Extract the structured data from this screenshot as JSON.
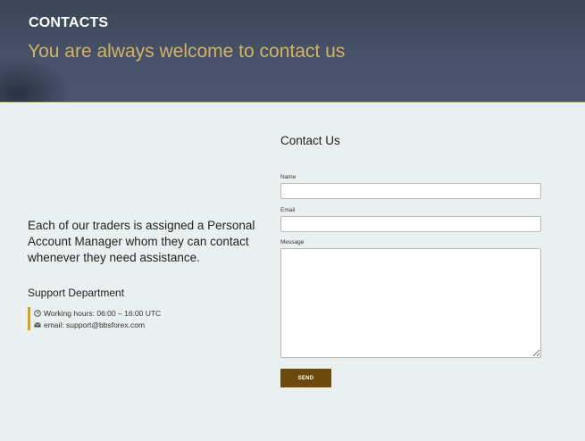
{
  "header": {
    "title": "CONTACTS",
    "subtitle": "You are always welcome to contact us"
  },
  "info": {
    "description": "Each of our traders is assigned a Personal Account Manager whom they can contact whenever they need assistance.",
    "support_title": "Support Department",
    "working_hours": "Working hours: 06:00 – 16:00 UTC",
    "email": "email: support@bbsforex.com",
    "accent_color": "#d6a21e",
    "icons": [
      "clock-icon",
      "envelope-icon"
    ]
  },
  "form": {
    "title": "Contact Us",
    "name_label": "Name",
    "name_value": "",
    "email_label": "Email",
    "email_value": "",
    "message_label": "Message",
    "message_value": "",
    "send_label": "SEND",
    "send_color": "#6b4a0c"
  },
  "colors": {
    "header_bg": "#424d62",
    "subtitle": "#d6b25e",
    "page_bg": "#eaeff0"
  }
}
